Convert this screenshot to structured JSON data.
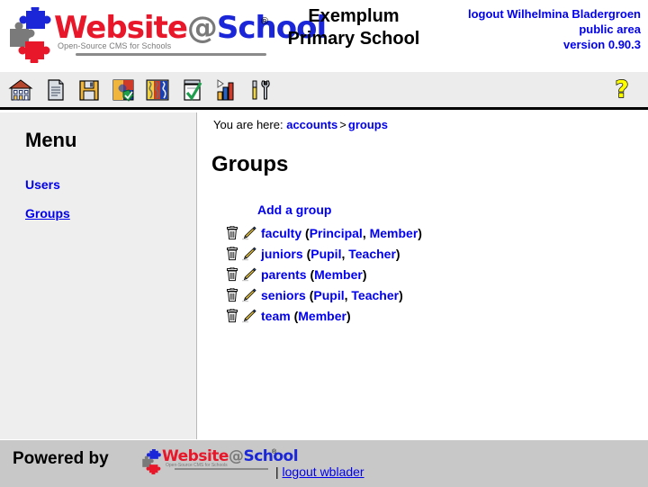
{
  "header": {
    "logo": {
      "word_part1": "Website",
      "word_at": "@",
      "word_part2": "School",
      "tagline": "Open-Source CMS for Schools",
      "registered_mark": "®"
    },
    "school_name_line1": "Exemplum",
    "school_name_line2": "Primary School",
    "logout_label": "logout Wilhelmina Bladergroen",
    "area_label": "public area",
    "version_label": "version 0.90.3"
  },
  "toolbar": {
    "items": [
      {
        "name": "home-icon",
        "title": "Home"
      },
      {
        "name": "page-icon",
        "title": "Page"
      },
      {
        "name": "save-floppy-icon",
        "title": "Save"
      },
      {
        "name": "modules-icon",
        "title": "Modules"
      },
      {
        "name": "areas-icon",
        "title": "Areas"
      },
      {
        "name": "checklist-icon",
        "title": "Tasks"
      },
      {
        "name": "statistics-bar-chart-icon",
        "title": "Statistics"
      },
      {
        "name": "tools-icon",
        "title": "Tools"
      }
    ],
    "help": {
      "name": "help-question-icon",
      "title": "Help",
      "glyph": "?"
    }
  },
  "sidebar": {
    "title": "Menu",
    "items": [
      {
        "label": "Users",
        "current": false
      },
      {
        "label": "Groups",
        "current": true
      }
    ]
  },
  "content": {
    "breadcrumb": {
      "prefix": "You are here:",
      "crumb1": "accounts",
      "separator": ">",
      "crumb2": "groups"
    },
    "heading": "Groups",
    "add_link": "Add a group",
    "groups": [
      {
        "delete_icon": "trash-icon",
        "edit_icon": "pencil-icon",
        "name": "faculty",
        "open_paren": "(",
        "roles": [
          "Principal",
          "Member"
        ],
        "close_paren": ")"
      },
      {
        "delete_icon": "trash-icon",
        "edit_icon": "pencil-icon",
        "name": "juniors",
        "open_paren": "(",
        "roles": [
          "Pupil",
          "Teacher"
        ],
        "close_paren": ")"
      },
      {
        "delete_icon": "trash-icon",
        "edit_icon": "pencil-icon",
        "name": "parents",
        "open_paren": "(",
        "roles": [
          "Member"
        ],
        "close_paren": ")"
      },
      {
        "delete_icon": "trash-icon",
        "edit_icon": "pencil-icon",
        "name": "seniors",
        "open_paren": "(",
        "roles": [
          "Pupil",
          "Teacher"
        ],
        "close_paren": ")"
      },
      {
        "delete_icon": "trash-icon",
        "edit_icon": "pencil-icon",
        "name": "team",
        "open_paren": "(",
        "roles": [
          "Member"
        ],
        "close_paren": ")"
      }
    ]
  },
  "footer": {
    "powered_by": "Powered by",
    "logo": {
      "word_part1": "Website",
      "word_at": "@",
      "word_part2": "School",
      "tagline": "Open-Source CMS for Schools",
      "registered_mark": "®"
    },
    "separator": "|",
    "logout_label": "logout wblader"
  },
  "colors": {
    "link_blue": "#0000ee",
    "logo_red": "#e8172a",
    "logo_blue": "#1a26d8",
    "logo_gray": "#7a7a7a",
    "toolbar_bg": "#ececec",
    "sidebar_bg": "#eeeeee",
    "footer_bg": "#c8c8c8",
    "help_yellow": "#ffff00"
  }
}
